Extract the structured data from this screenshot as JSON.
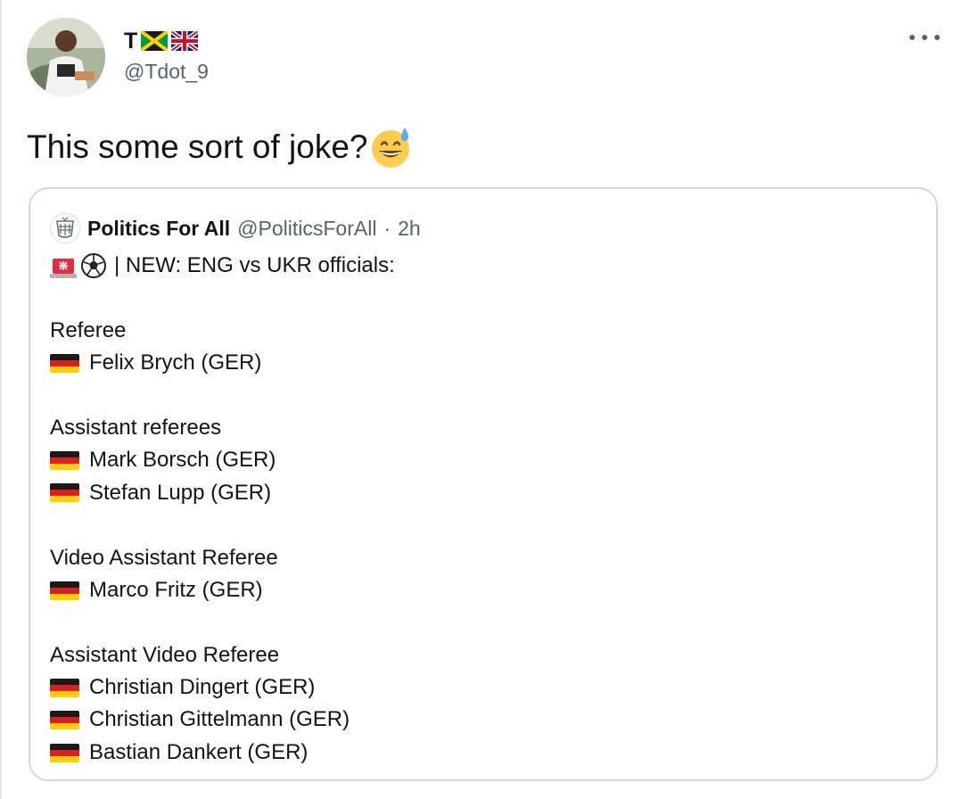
{
  "tweet": {
    "display_name": "T",
    "name_flags": [
      "jamaica-flag-icon",
      "uk-flag-icon"
    ],
    "handle": "@Tdot_9",
    "text": "This some sort of joke?",
    "text_emoji": "sweat-smile-emoji-icon"
  },
  "quoted": {
    "name": "Politics For All",
    "handle": "@PoliticsForAll",
    "separator": "·",
    "time": "2h",
    "headline": "| NEW: ENG vs UKR officials:",
    "headline_icons": [
      "siren-icon",
      "soccer-ball-icon"
    ],
    "sections": [
      {
        "title": "Referee",
        "people": [
          "Felix Brych (GER)"
        ]
      },
      {
        "title": "Assistant referees",
        "people": [
          "Mark Borsch (GER)",
          "Stefan Lupp (GER)"
        ]
      },
      {
        "title": "Video Assistant Referee",
        "people": [
          "Marco Fritz (GER)"
        ]
      },
      {
        "title": "Assistant Video Referee",
        "people": [
          "Christian Dingert (GER)",
          "Christian Gittelmann (GER)",
          "Bastian Dankert (GER)"
        ]
      }
    ]
  },
  "colors": {
    "text": "#0f1419",
    "secondary": "#536471",
    "border": "#cfd9de",
    "germany": [
      "#1a1a1a",
      "#dd1e1e",
      "#ffce00"
    ]
  }
}
